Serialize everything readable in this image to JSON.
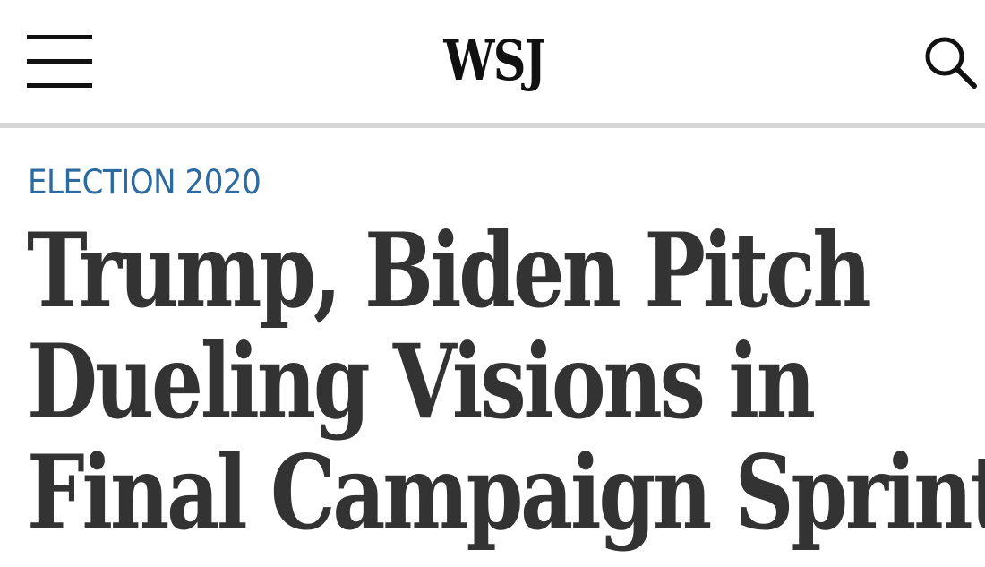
{
  "header": {
    "logo_text": "WSJ",
    "menu_icon": "hamburger-menu-icon",
    "search_icon": "search-icon"
  },
  "article": {
    "section_label": "ELECTION 2020",
    "headline_lines": [
      "Trump, Biden Pitch",
      "Dueling Visions in",
      "Final Campaign Sprint"
    ]
  },
  "colors": {
    "section_label": "#2c6aa0",
    "headline": "#333333",
    "divider": "#d6d6d6"
  }
}
